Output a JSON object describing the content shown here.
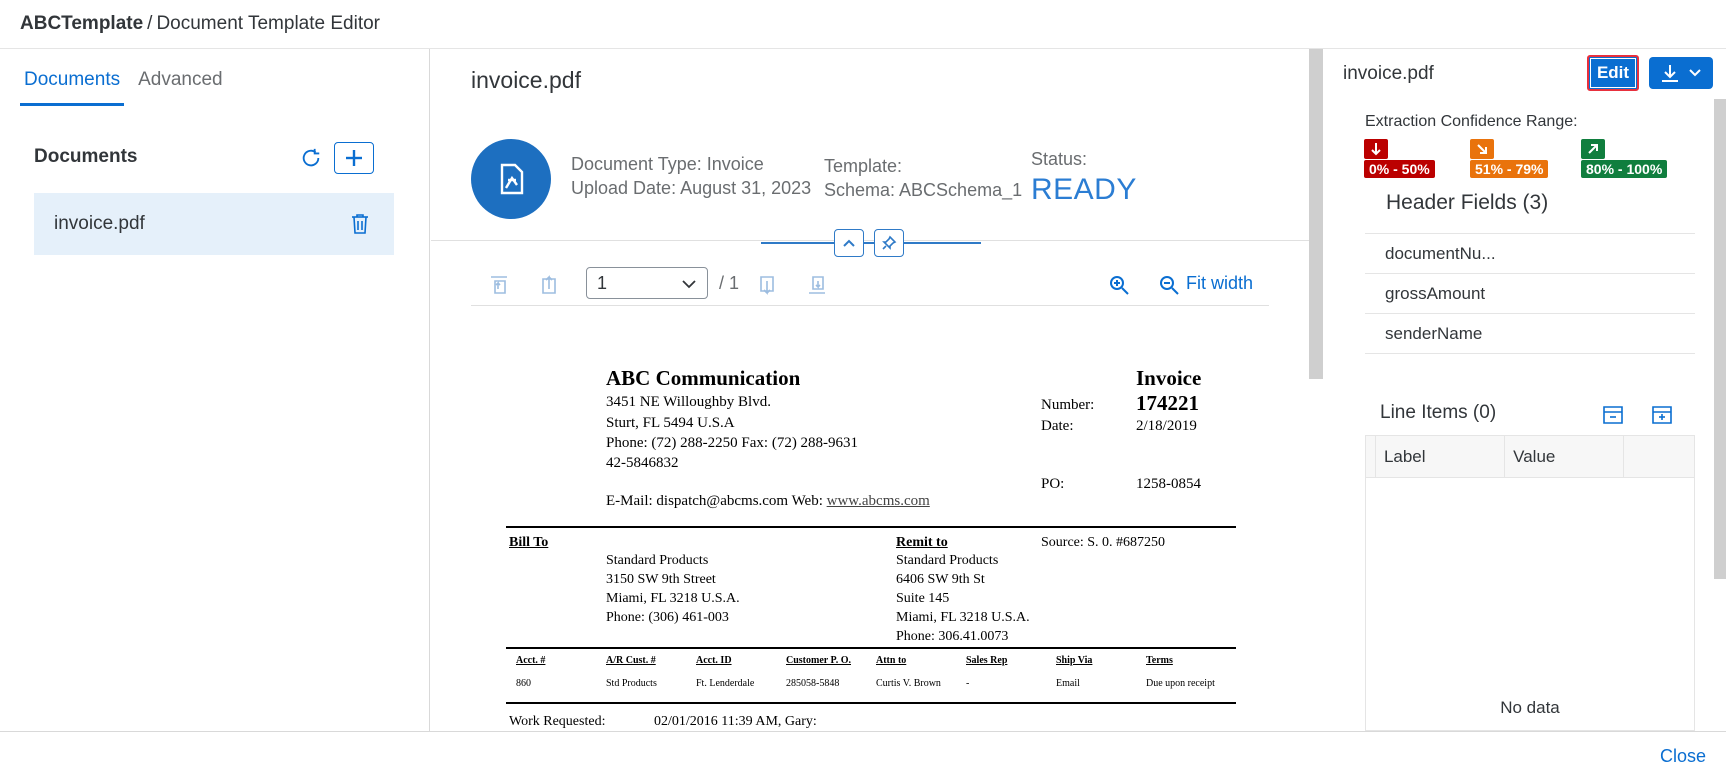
{
  "header": {
    "app_name": "ABCTemplate",
    "separator": "/",
    "page_title": "Document Template Editor"
  },
  "left": {
    "tabs": [
      {
        "label": "Documents"
      },
      {
        "label": "Advanced"
      }
    ],
    "section_title": "Documents",
    "documents": [
      {
        "name": "invoice.pdf"
      }
    ]
  },
  "center": {
    "title": "invoice.pdf",
    "doc_type": "Document Type: Invoice",
    "upload_date": "Upload Date: August 31, 2023",
    "template_label": "Template:",
    "schema": "Schema: ABCSchema_1",
    "status_label": "Status:",
    "status_value": "READY",
    "toolbar": {
      "page_value": "1",
      "page_total": "/ 1",
      "fit_width": "Fit width"
    }
  },
  "pdf": {
    "company": "ABC Communication",
    "address_lines": [
      "3451 NE Willoughby Blvd.",
      "Sturt, FL 5494 U.S.A",
      "Phone: (72) 288-2250   Fax: (72) 288-9631",
      "42-5846832"
    ],
    "email_line": "E-Mail: dispatch@abcms.com Web: ",
    "web": "www.abcms.com",
    "invoice_title": "Invoice",
    "number_label": "Number:",
    "number_value": "174221",
    "date_label": "Date:",
    "date_value": "2/18/2019",
    "po_label": "PO:",
    "po_value": "1258-0854",
    "bill_to_label": "Bill To",
    "bill_to": [
      "Standard Products",
      "3150 SW 9th Street",
      "Miami, FL 3218 U.S.A.",
      "Phone: (306) 461-003"
    ],
    "remit_to_label": "Remit to",
    "remit_to": [
      "Standard Products",
      "6406 SW 9th St",
      "Suite 145",
      "Miami, FL 3218 U.S.A.",
      "Phone: 306.41.0073"
    ],
    "source": "Source: S. 0. #687250",
    "table_headers": [
      "Acct. #",
      "A/R Cust. #",
      "Acct. ID",
      "Customer P. O.",
      "Attn to",
      "Sales Rep",
      "Ship Via",
      "Terms"
    ],
    "table_row": [
      "860",
      "Std Products",
      "Ft. Lenderdale",
      "285058-5848",
      "Curtis V. Brown",
      "-",
      "Email",
      "Due upon receipt"
    ],
    "work_requested_label": "Work Requested:",
    "work_requested_value": "02/01/2016 11:39 AM, Gary:"
  },
  "right": {
    "title": "invoice.pdf",
    "edit_label": "Edit",
    "confidence_title": "Extraction Confidence Range:",
    "confidence_ranges": [
      {
        "label": "0% - 50%",
        "color": "#bb0000"
      },
      {
        "label": "51% - 79%",
        "color": "#e9730c"
      },
      {
        "label": "80% - 100%",
        "color": "#107e3e"
      }
    ],
    "header_fields_title": "Header Fields (3)",
    "header_fields": [
      {
        "name": "documentNu..."
      },
      {
        "name": "grossAmount"
      },
      {
        "name": "senderName"
      }
    ],
    "line_items_title": "Line Items (0)",
    "line_items_columns": [
      "Label",
      "Value"
    ],
    "no_data": "No data"
  },
  "footer": {
    "close_label": "Close"
  },
  "colors": {
    "accent": "#0a6ed1",
    "selected_bg": "#e5f0fa",
    "avatar": "#1d6fc0",
    "status": "#2b7dd3"
  }
}
